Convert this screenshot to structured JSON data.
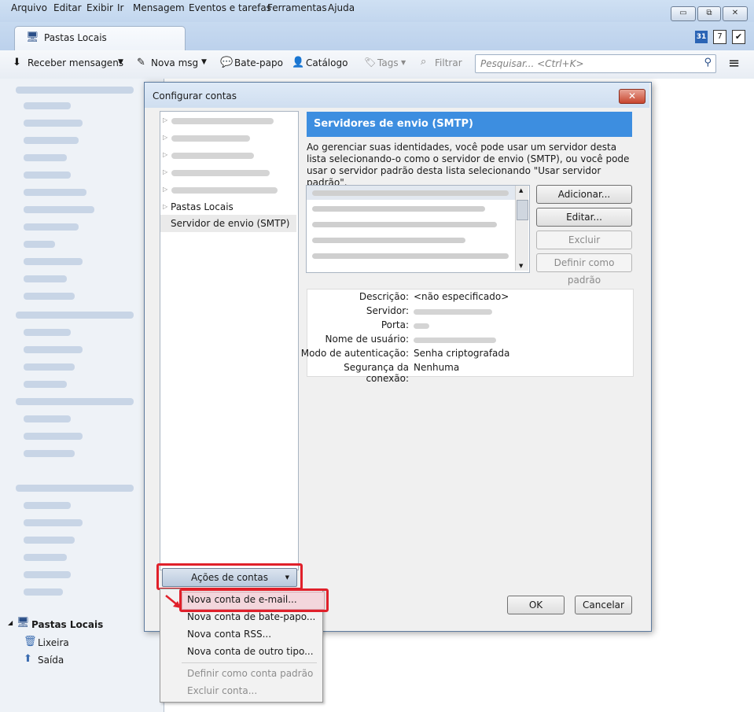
{
  "menubar": [
    "Arquivo",
    "Editar",
    "Exibir",
    "Ir",
    "Mensagem",
    "Eventos e tarefas",
    "Ferramentas",
    "Ajuda"
  ],
  "window_controls": {
    "minimize": "▭",
    "restore": "⧉",
    "close": "✕"
  },
  "tab": {
    "title": "Pastas Locais"
  },
  "toolbar": {
    "receive": "Receber mensagens",
    "new_msg": "Nova msg",
    "chat": "Bate-papo",
    "catalog": "Catálogo",
    "tags": "Tags",
    "filter": "Filtrar",
    "search_placeholder": "Pesquisar... <Ctrl+K>"
  },
  "calendar_badge": "31",
  "tasks_badge": "7",
  "dialog": {
    "title": "Configurar contas",
    "close": "✕",
    "account_list": {
      "pastas_locais": "Pastas Locais",
      "smtp": "Servidor de envio (SMTP)"
    },
    "smtp": {
      "header": "Servidores de envio (SMTP)",
      "description": "Ao gerenciar suas identidades, você pode usar um servidor desta lista selecionando-o como o servidor de envio (SMTP), ou você pode usar o servidor padrão desta lista selecionando \"Usar servidor padrão\".",
      "buttons": {
        "add": "Adicionar...",
        "edit": "Editar...",
        "delete": "Excluir",
        "default": "Definir como padrão"
      },
      "details": {
        "description_label": "Descrição:",
        "description_value": "<não especificado>",
        "server_label": "Servidor:",
        "port_label": "Porta:",
        "username_label": "Nome de usuário:",
        "auth_label": "Modo de autenticação:",
        "auth_value": "Senha criptografada",
        "security_label": "Segurança da conexão:",
        "security_value": "Nenhuma"
      }
    },
    "account_actions": "Ações de contas",
    "ok": "OK",
    "cancel": "Cancelar"
  },
  "actions_menu": {
    "new_email": "Nova conta de e-mail...",
    "new_chat": "Nova conta de bate-papo...",
    "new_rss": "Nova conta RSS...",
    "new_other": "Nova conta de outro tipo...",
    "set_default": "Definir como conta padrão",
    "delete": "Excluir conta..."
  },
  "folder_tree": {
    "root": "Pastas Locais",
    "trash": "Lixeira",
    "outbox": "Saída"
  },
  "colors": {
    "highlight": "#e0202a",
    "header_blue": "#3d8ee0"
  }
}
